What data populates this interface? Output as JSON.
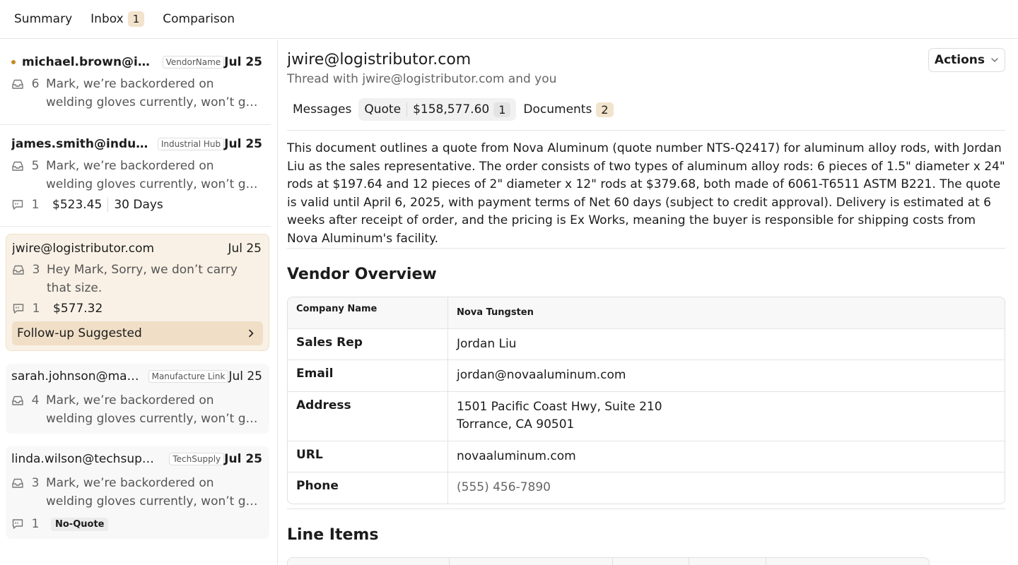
{
  "nav": {
    "summary": "Summary",
    "inbox": "Inbox",
    "inbox_count": "1",
    "comparison": "Comparison"
  },
  "threads": [
    {
      "sender": "michael.brown@ind...",
      "tag": "VendorName",
      "date": "Jul 25",
      "count": "6",
      "preview": "Mark, we’re backordered on welding gloves currently, won’t get them in for..."
    },
    {
      "sender": "james.smith@industr...",
      "tag": "Industrial Hub",
      "date": "Jul 25",
      "count": "5",
      "preview": "Mark, we’re backordered on welding gloves currently, won’t get them in for...",
      "quote_count": "1",
      "quote_amount": "$523.45",
      "quote_terms": "30 Days"
    },
    {
      "sender": "jwire@logistributor.com",
      "date": "Jul 25",
      "count": "3",
      "preview": "Hey Mark, Sorry, we don’t carry that size.",
      "quote_count": "1",
      "quote_amount": "$577.32",
      "followup": "Follow-up Suggested"
    },
    {
      "sender": "sarah.johnson@man...",
      "tag": "Manufacture Link",
      "date": "Jul 25",
      "count": "4",
      "preview": "Mark, we’re backordered on welding gloves currently, won’t get them in for..."
    },
    {
      "sender": "linda.wilson@techsupply....",
      "tag": "TechSupply",
      "date": "Jul 25",
      "count": "3",
      "preview": "Mark, we’re backordered on welding gloves currently, won’t get them in for...",
      "quote_count": "1",
      "quote_status": "No-Quote"
    }
  ],
  "main": {
    "title": "jwire@logistributor.com",
    "subtitle": "Thread with jwire@logistributor.com and you",
    "actions": "Actions",
    "tabs": {
      "messages": "Messages",
      "quote": "Quote",
      "quote_amount": "$158,577.60",
      "quote_count": "1",
      "documents": "Documents",
      "documents_count": "2"
    },
    "summary": "This document outlines a quote from Nova Aluminum (quote number NTS-Q2417) for aluminum alloy rods, with Jordan Liu as the sales representative. The order consists of two types of aluminum alloy rods: 6 pieces of 1.5\" diameter x 24\" rods at $197.64 and 12 pieces of 2\" diameter x 12\" rods at $379.68, both made of 6061-T6511 ASTM B221. The quote is valid until April 6, 2025, with payment terms of Net 60 days (subject to credit approval). Delivery is estimated at 6 weeks after receipt of order, and the pricing is Ex Works, meaning the buyer is responsible for shipping costs from Nova Aluminum's facility.",
    "vendor_overview_title": "Vendor Overview",
    "vendor": {
      "company_label": "Company Name",
      "company": "Nova Tungsten",
      "rep_label": "Sales Rep",
      "rep": "Jordan Liu",
      "email_label": "Email",
      "email": "jordan@novaaluminum.com",
      "address_label": "Address",
      "address_line1": "1501 Pacific Coast Hwy, Suite 210",
      "address_line2": "Torrance, CA 90501",
      "url_label": "URL",
      "url": "novaaluminum.com",
      "phone_label": "Phone",
      "phone": "(555) 456-7890"
    },
    "line_items_title": "Line Items"
  }
}
